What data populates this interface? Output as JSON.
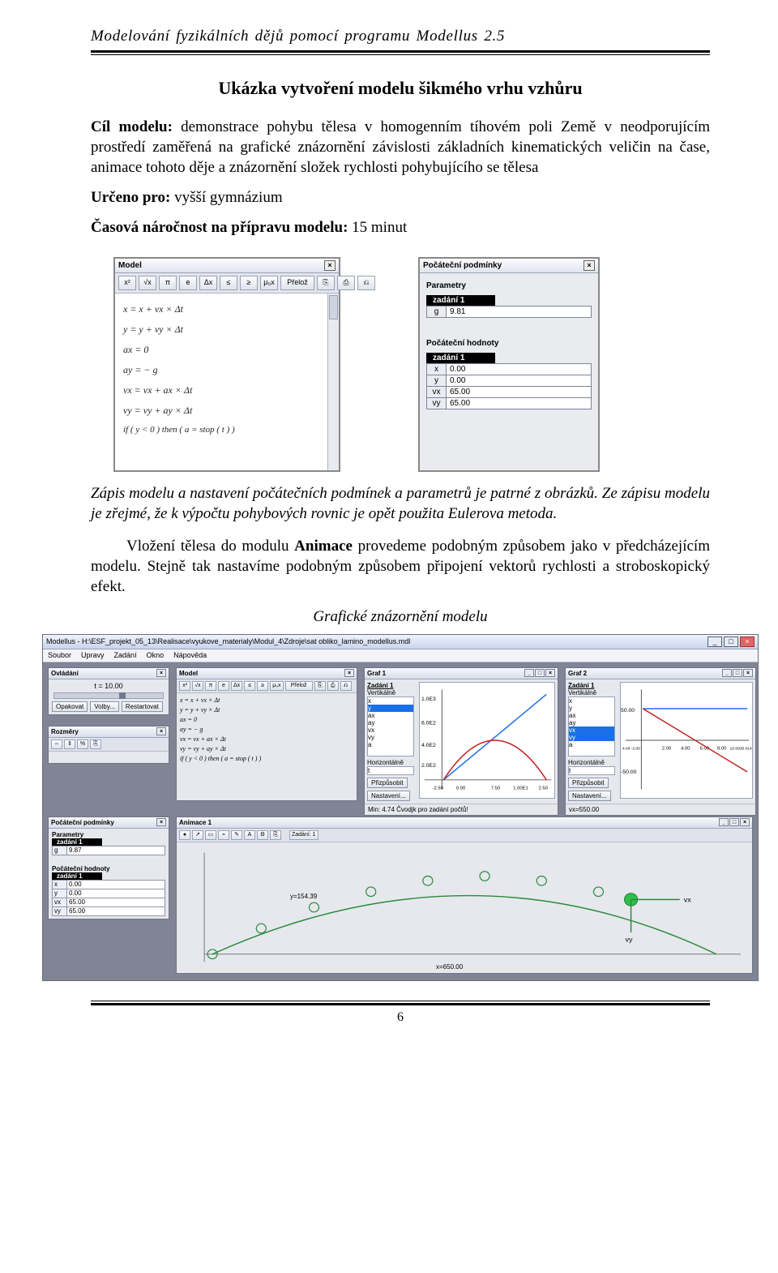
{
  "header": {
    "running": "Modelování fyzikálních dějů pomocí programu Modellus 2.5"
  },
  "section_title": "Ukázka vytvoření modelu šikmého vrhu vzhůru",
  "p_goal": {
    "label": "Cíl modelu: ",
    "text": "demonstrace pohybu tělesa v homogenním tíhovém poli Země v neodporujícím prostředí zaměřená na grafické znázornění závislosti základních kinematických veličin na čase, animace tohoto děje a znázornění složek rychlosti pohybujícího se tělesa"
  },
  "p_target": {
    "label": "Určeno pro: ",
    "text": "vyšší gymnázium"
  },
  "p_time": {
    "label": "Časová náročnost na přípravu modelu: ",
    "text": "15 minut"
  },
  "model_win": {
    "title": "Model",
    "tool": [
      "x²",
      "√x",
      "π",
      "e",
      "Δx",
      "≤",
      "≥",
      "μ₀x",
      "Přelož",
      "⎘",
      "⎙",
      "⎌"
    ],
    "eqs": [
      "x = x + vx × Δt",
      "y = y + vy × Δt",
      "ax = 0",
      "ay = − g",
      "vx = vx + ax × Δt",
      "vy = vy + ay × Δt",
      "if ( y < 0 ) then ( a = stop ( t ) )"
    ]
  },
  "cond_win": {
    "title": "Počáteční podmínky",
    "params_h": "Parametry",
    "tab": "zadání 1",
    "params": [
      {
        "k": "g",
        "v": "9.81"
      }
    ],
    "init_h": "Počáteční hodnoty",
    "init": [
      {
        "k": "x",
        "v": "0.00"
      },
      {
        "k": "y",
        "v": "0.00"
      },
      {
        "k": "vx",
        "v": "65.00"
      },
      {
        "k": "vy",
        "v": "65.00"
      }
    ]
  },
  "caption1": "Zápis modelu a nastavení počátečních podmínek a parametrů je patrné z obrázků. Ze zápisu modelu je zřejmé, že k výpočtu pohybových rovnic je opět použita Eulerova metoda.",
  "p_insert_1": "Vložení tělesa do modulu ",
  "p_insert_b": "Animace",
  "p_insert_2": " provedeme podobným způsobem jako v předcházejícím modelu. Stejně tak nastavíme podobným způsobem připojení vektorů rychlosti a stroboskopický efekt.",
  "caption2": "Grafické znázornění modelu",
  "app": {
    "title": "Modellus - H:\\ESF_projekt_05_13\\Realisace\\vyukove_materialy\\Modul_4\\Zdroje\\sat obliko_lamino_modellus.mdl",
    "menu": [
      "Soubor",
      "Upravy",
      "Zadání",
      "Okno",
      "Nápověda"
    ],
    "ovladani": {
      "title": "Ovládání",
      "t_label": "t = ",
      "t_val": "10.00",
      "btns": [
        "Opakovat",
        "Volby...",
        "Restartovat"
      ]
    },
    "rozměry": {
      "title": "Rozměry",
      "tool": [
        "⇔",
        "⇕",
        "%",
        "⎘"
      ]
    },
    "model": {
      "title": "Model",
      "tool": [
        "x²",
        "√x",
        "π",
        "e",
        "Δx",
        "≤",
        "≥",
        "μ₀x",
        "Přelož",
        "⎘",
        "⎙",
        "⎌"
      ],
      "eqs": [
        "x = x + vx × Δt",
        "y = y + vy × Δt",
        "ax = 0",
        "ay = − g",
        "vx = vx + ax × Δt",
        "vy = vy + ay × Δt",
        "if ( y < 0 ) then ( a = stop ( t ) )"
      ]
    },
    "graf1": {
      "title": "Graf 1",
      "zadani": "Zadání 1",
      "vert": "Vertikálně",
      "vars": [
        "x",
        "y",
        "ax",
        "ay",
        "vx",
        "vy",
        "a"
      ],
      "sel": 1,
      "yticks": [
        "1.0E3",
        "6.0E2",
        "4.0E2",
        "2.0E2"
      ],
      "horiz": "Horizontálně",
      "hvar": "t",
      "xticks": [
        "-2.50",
        "0.00",
        "7.50",
        "1.00E1",
        "2.50"
      ],
      "btns": [
        "Přizpůsobit",
        "Nastavení..."
      ],
      "footer": "Min:   4.74         Čvodjk pro zadání počtů!"
    },
    "graf2": {
      "title": "Graf 2",
      "zadani": "Zadání 1",
      "vert": "Vertikálně",
      "vars": [
        "x",
        "y",
        "ax",
        "ay",
        "vx",
        "vy",
        "a"
      ],
      "sel": [
        4,
        5
      ],
      "yticks": [
        "50.00",
        "-50.00"
      ],
      "horiz": "Horizontálně",
      "hvar": "t",
      "xticks": [
        "4.04 -2.00",
        "2.00",
        "4.00",
        "6.00",
        "8.00",
        "10.0030.014.0"
      ],
      "btns": [
        "Přizpůsobit",
        "Nastavení..."
      ],
      "footer": "vx=550.00"
    },
    "pocpod": {
      "title": "Počáteční podmínky",
      "params_h": "Parametry",
      "tab": "zadání 1",
      "params": [
        {
          "k": "g",
          "v": "9.87"
        }
      ],
      "init_h": "Počáteční hodnoty",
      "init": [
        {
          "k": "x",
          "v": "0.00"
        },
        {
          "k": "y",
          "v": "0.00"
        },
        {
          "k": "vx",
          "v": "65.00"
        },
        {
          "k": "vy",
          "v": "65.00"
        }
      ]
    },
    "animace": {
      "title": "Animace 1",
      "zadani": "Zadání: 1",
      "y_label": "y=154.39",
      "x_label": "x=650.00",
      "vec": {
        "vx": "vx",
        "vy": "vy"
      }
    }
  },
  "page_number": "6"
}
